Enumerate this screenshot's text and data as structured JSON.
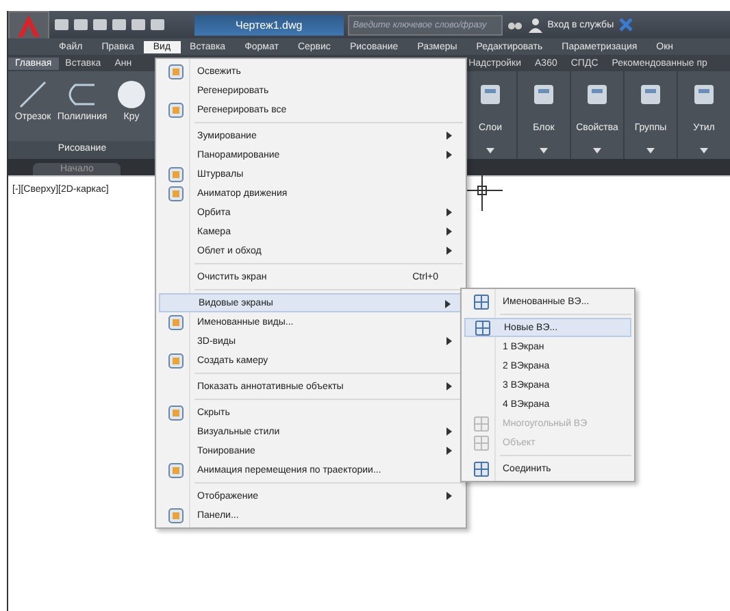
{
  "title_bar": {
    "file_name": "Чертеж1.dwg",
    "search": {
      "placeholder": "Введите ключевое слово/фразу"
    },
    "sign_in": "Вход в службы"
  },
  "menu_bar": [
    {
      "label": "Файл",
      "selected": false
    },
    {
      "label": "Правка",
      "selected": false
    },
    {
      "label": "Вид",
      "selected": true
    },
    {
      "label": "Вставка",
      "selected": false
    },
    {
      "label": "Формат",
      "selected": false
    },
    {
      "label": "Сервис",
      "selected": false
    },
    {
      "label": "Рисование",
      "selected": false
    },
    {
      "label": "Размеры",
      "selected": false
    },
    {
      "label": "Редактировать",
      "selected": false
    },
    {
      "label": "Параметризация",
      "selected": false
    },
    {
      "label": "Окн",
      "selected": false
    }
  ],
  "ribbon_tabs_left": [
    {
      "label": "Главная",
      "selected": true
    },
    {
      "label": "Вставка",
      "selected": false
    },
    {
      "label": "Анн",
      "selected": false
    }
  ],
  "ribbon_tabs_right": [
    {
      "label": "Надстройки",
      "selected": false
    },
    {
      "label": "А360",
      "selected": false
    },
    {
      "label": "СПДС",
      "selected": false
    },
    {
      "label": "Рекомендованные пр",
      "selected": false
    }
  ],
  "draw_tools": [
    "Отрезок",
    "Полилиния",
    "Кру"
  ],
  "draw_panel_title": "Рисование",
  "right_panels": [
    "Слои",
    "Блок",
    "Свойства",
    "Группы",
    "Утил"
  ],
  "doc_tab": "Начало",
  "viewport_label": "[-][Сверху][2D-каркас]",
  "view_menu": [
    {
      "kind": "item",
      "label": "Освежить",
      "icon": true,
      "submenu": false,
      "selected": false
    },
    {
      "kind": "item",
      "label": "Регенерировать",
      "icon": false,
      "submenu": false,
      "selected": false
    },
    {
      "kind": "item",
      "label": "Регенерировать все",
      "icon": true,
      "submenu": false,
      "selected": false
    },
    {
      "kind": "separator"
    },
    {
      "kind": "item",
      "label": "Зумирование",
      "icon": false,
      "submenu": true,
      "selected": false
    },
    {
      "kind": "item",
      "label": "Панорамирование",
      "icon": false,
      "submenu": true,
      "selected": false
    },
    {
      "kind": "item",
      "label": "Штурвалы",
      "icon": true,
      "submenu": false,
      "selected": false
    },
    {
      "kind": "item",
      "label": "Аниматор движения",
      "icon": true,
      "submenu": false,
      "selected": false
    },
    {
      "kind": "item",
      "label": "Орбита",
      "icon": false,
      "submenu": true,
      "selected": false
    },
    {
      "kind": "item",
      "label": "Камера",
      "icon": false,
      "submenu": true,
      "selected": false
    },
    {
      "kind": "item",
      "label": "Облет и обход",
      "icon": false,
      "submenu": true,
      "selected": false
    },
    {
      "kind": "separator"
    },
    {
      "kind": "item",
      "label": "Очистить экран",
      "icon": false,
      "submenu": false,
      "selected": false,
      "shortcut": "Ctrl+0"
    },
    {
      "kind": "separator"
    },
    {
      "kind": "item",
      "label": "Видовые экраны",
      "icon": false,
      "submenu": true,
      "selected": true
    },
    {
      "kind": "item",
      "label": "Именованные виды...",
      "icon": true,
      "submenu": false,
      "selected": false
    },
    {
      "kind": "item",
      "label": "3D-виды",
      "icon": false,
      "submenu": true,
      "selected": false
    },
    {
      "kind": "item",
      "label": "Создать камеру",
      "icon": true,
      "submenu": false,
      "selected": false
    },
    {
      "kind": "separator"
    },
    {
      "kind": "item",
      "label": "Показать аннотативные объекты",
      "icon": false,
      "submenu": true,
      "selected": false
    },
    {
      "kind": "separator"
    },
    {
      "kind": "item",
      "label": "Скрыть",
      "icon": true,
      "submenu": false,
      "selected": false
    },
    {
      "kind": "item",
      "label": "Визуальные стили",
      "icon": false,
      "submenu": true,
      "selected": false
    },
    {
      "kind": "item",
      "label": "Тонирование",
      "icon": false,
      "submenu": true,
      "selected": false
    },
    {
      "kind": "item",
      "label": "Анимация перемещения по траектории...",
      "icon": true,
      "submenu": false,
      "selected": false
    },
    {
      "kind": "separator"
    },
    {
      "kind": "item",
      "label": "Отображение",
      "icon": false,
      "submenu": true,
      "selected": false
    },
    {
      "kind": "item",
      "label": "Панели...",
      "icon": true,
      "submenu": false,
      "selected": false
    }
  ],
  "viewports_submenu": [
    {
      "kind": "item",
      "label": "Именованные ВЭ...",
      "icon": true,
      "selected": false,
      "disabled": false
    },
    {
      "kind": "separator"
    },
    {
      "kind": "item",
      "label": "Новые ВЭ...",
      "icon": true,
      "selected": true,
      "disabled": false
    },
    {
      "kind": "item",
      "label": "1 ВЭкран",
      "icon": false,
      "selected": false,
      "disabled": false
    },
    {
      "kind": "item",
      "label": "2 ВЭкрана",
      "icon": false,
      "selected": false,
      "disabled": false
    },
    {
      "kind": "item",
      "label": "3 ВЭкрана",
      "icon": false,
      "selected": false,
      "disabled": false
    },
    {
      "kind": "item",
      "label": "4 ВЭкрана",
      "icon": false,
      "selected": false,
      "disabled": false
    },
    {
      "kind": "item",
      "label": "Многоугольный ВЭ",
      "icon": true,
      "selected": false,
      "disabled": true
    },
    {
      "kind": "item",
      "label": "Объект",
      "icon": true,
      "selected": false,
      "disabled": true
    },
    {
      "kind": "separator"
    },
    {
      "kind": "item",
      "label": "Соединить",
      "icon": true,
      "selected": false,
      "disabled": false
    }
  ]
}
